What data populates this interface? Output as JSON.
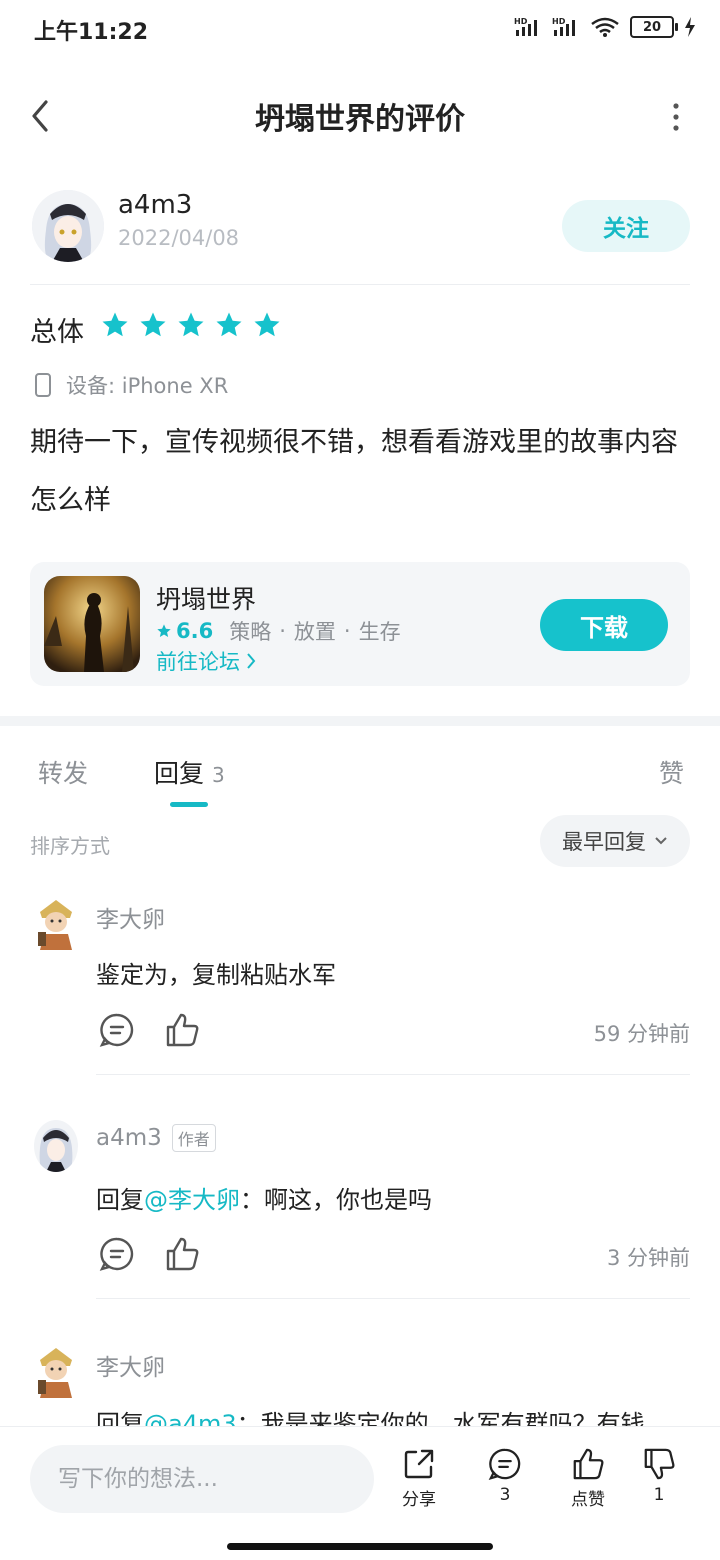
{
  "status_bar": {
    "time": "上午11:22",
    "battery": "20",
    "signal1": "HD",
    "signal2": "HD"
  },
  "header": {
    "title": "坍塌世界的评价"
  },
  "review": {
    "username": "a4m3",
    "date": "2022/04/08",
    "follow_label": "关注",
    "overall_label": "总体",
    "rating_stars": 5,
    "device": "设备: iPhone XR",
    "text": "期待一下，宣传视频很不错，想看看游戏里的故事内容怎么样"
  },
  "game": {
    "name": "坍塌世界",
    "rating": "6.6",
    "tags": [
      "策略",
      "放置",
      "生存"
    ],
    "forum_link": "前往论坛",
    "download_label": "下载"
  },
  "tabs": {
    "forward": "转发",
    "reply": "回复",
    "reply_count": "3",
    "like": "赞"
  },
  "sort": {
    "label": "排序方式",
    "selected": "最早回复"
  },
  "comments": [
    {
      "name": "李大卵",
      "badge": "",
      "prefix": "",
      "mention": "",
      "text": "鉴定为，复制粘贴水军",
      "time": "59 分钟前"
    },
    {
      "name": "a4m3",
      "badge": "作者",
      "prefix": "回复",
      "mention": "@李大卵",
      "text": "：啊这，你也是吗",
      "time": "3 分钟前"
    },
    {
      "name": "李大卵",
      "badge": "",
      "prefix": "回复",
      "mention": "@a4m3",
      "text": "：我是来鉴定你的，水军有群吗？有钱",
      "time": ""
    }
  ],
  "bottom_bar": {
    "input_placeholder": "写下你的想法...",
    "share_label": "分享",
    "comment_count": "3",
    "like_label": "点赞",
    "dislike_count": "1"
  },
  "colors": {
    "accent": "#16b9c5",
    "text": "#222222",
    "muted": "#8d9196"
  }
}
